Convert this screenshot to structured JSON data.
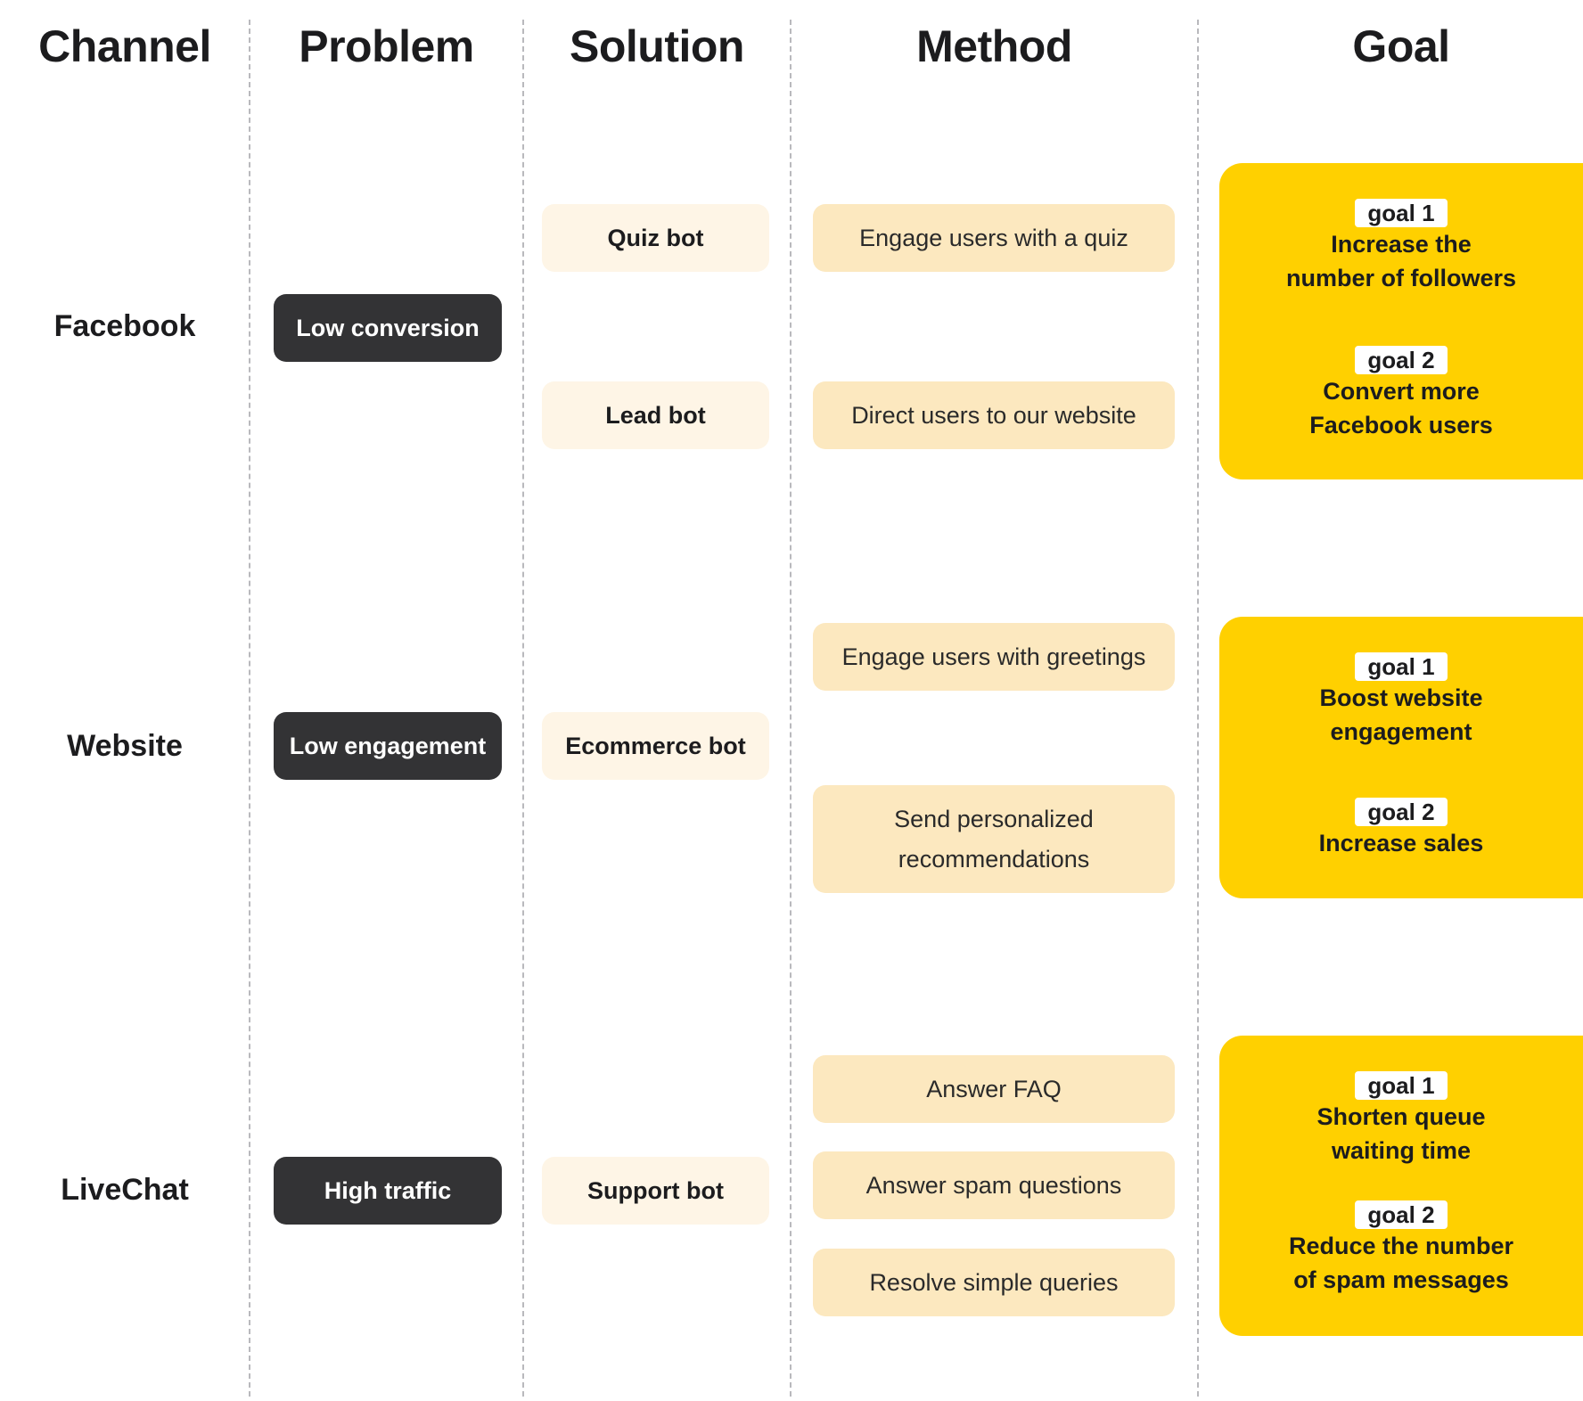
{
  "headers": {
    "channel": "Channel",
    "problem": "Problem",
    "solution": "Solution",
    "method": "Method",
    "goal": "Goal"
  },
  "colors": {
    "problem_bg": "#333335",
    "solution_bg": "#fef5e6",
    "method_bg": "#fce8bf",
    "goal_bg": "#ffd000",
    "goal_tag_bg": "#ffffff",
    "text": "#1c1c1e"
  },
  "rows": [
    {
      "channel": "Facebook",
      "problem": "Low conversion",
      "solutions": [
        "Quiz bot",
        "Lead bot"
      ],
      "methods": [
        "Engage users with a quiz",
        "Direct users to our website"
      ],
      "goals": [
        {
          "tag": "goal 1",
          "line1": "Increase the",
          "line2": "number of followers"
        },
        {
          "tag": "goal 2",
          "line1": "Convert more",
          "line2": "Facebook users"
        }
      ]
    },
    {
      "channel": "Website",
      "problem": "Low engagement",
      "solutions": [
        "Ecommerce bot"
      ],
      "methods": [
        "Engage users with greetings",
        "Send personalized recommendations"
      ],
      "goals": [
        {
          "tag": "goal 1",
          "line1": "Boost website",
          "line2": "engagement"
        },
        {
          "tag": "goal 2",
          "line1": "Increase sales",
          "line2": ""
        }
      ]
    },
    {
      "channel": "LiveChat",
      "problem": "High traffic",
      "solutions": [
        "Support bot"
      ],
      "methods": [
        "Answer FAQ",
        "Answer spam questions",
        "Resolve simple queries"
      ],
      "goals": [
        {
          "tag": "goal 1",
          "line1": "Shorten queue",
          "line2": "waiting time"
        },
        {
          "tag": "goal 2",
          "line1": "Reduce the number",
          "line2": "of spam messages"
        }
      ]
    }
  ]
}
